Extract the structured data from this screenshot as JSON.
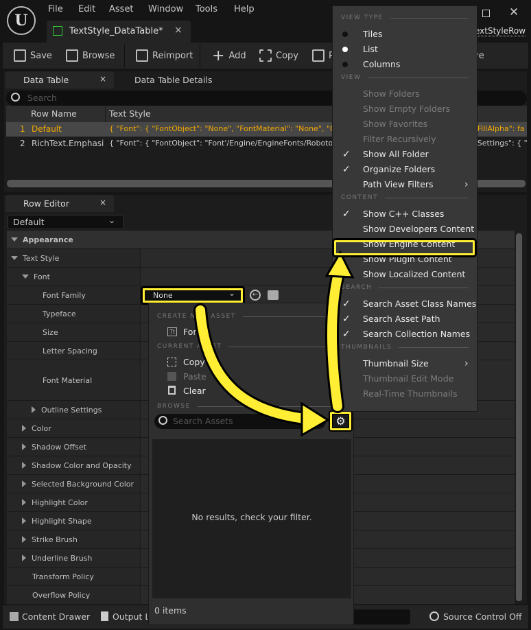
{
  "menu": [
    "File",
    "Edit",
    "Asset",
    "Window",
    "Tools",
    "Help"
  ],
  "asset_tab": {
    "label": "TextStyle_DataTable*",
    "close": "×"
  },
  "row_struct_link": "extStyleRow",
  "toolbar": {
    "save": "Save",
    "browse": "Browse",
    "reimport": "Reimport",
    "add": "Add",
    "copy": "Copy",
    "paste": "P",
    "remove": "ve"
  },
  "panel_tabs": {
    "data_table": "Data Table",
    "details": "Data Table Details",
    "close": "×"
  },
  "search": {
    "placeholder": "Search"
  },
  "table": {
    "headers": [
      "Row Name",
      "Text Style"
    ],
    "rows": [
      {
        "index": "1",
        "name": "Default",
        "value": "{ \"Font\": { \"FontObject\": \"None\", \"FontMaterial\": \"None\", \"Outlin",
        "tail": "eFillAlpha\": fa"
      },
      {
        "index": "2",
        "name": "RichText.Emphasis",
        "value": "{ \"Font\": { \"FontObject\": \"Font'/Engine/EngineFonts/Roboto.R",
        "tail": "eSettings\": { \""
      }
    ]
  },
  "row_editor": {
    "tab": "Row Editor",
    "close": "×",
    "selected_row": "Default",
    "properties": [
      {
        "label": "Appearance",
        "type": "category"
      },
      {
        "label": "Text Style",
        "type": "expanded"
      },
      {
        "label": "Font",
        "type": "expanded"
      },
      {
        "label": "Font Family"
      },
      {
        "label": "Typeface"
      },
      {
        "label": "Size"
      },
      {
        "label": "Letter Spacing"
      },
      {
        "label": "Font Material"
      },
      {
        "label": "Outline Settings",
        "type": "collapsed"
      },
      {
        "label": "Color",
        "type": "collapsed"
      },
      {
        "label": "Shadow Offset",
        "type": "collapsed"
      },
      {
        "label": "Shadow Color and Opacity",
        "type": "collapsed"
      },
      {
        "label": "Selected Background Color",
        "type": "collapsed"
      },
      {
        "label": "Highlight Color",
        "type": "collapsed"
      },
      {
        "label": "Highlight Shape",
        "type": "collapsed"
      },
      {
        "label": "Strike Brush",
        "type": "collapsed"
      },
      {
        "label": "Underline Brush",
        "type": "collapsed"
      },
      {
        "label": "Transform Policy"
      },
      {
        "label": "Overflow Policy"
      }
    ]
  },
  "font_family_value": "None",
  "asset_picker": {
    "create_header": "CREATE NEW ASSET",
    "create_item": "Font",
    "current_header": "CURRENT ASSET",
    "copy": "Copy",
    "paste": "Paste",
    "clear": "Clear",
    "browse_header": "BROWSE",
    "search_placeholder": "Search Assets",
    "empty": "No results, check your filter.",
    "count": "0 items"
  },
  "statusbar": {
    "content_drawer": "Content Drawer",
    "output_log": "Output Log",
    "source_control": "Source Control Off"
  },
  "view_menu": {
    "sections": [
      {
        "header": "VIEW TYPE",
        "items": [
          {
            "label": "Tiles",
            "radio": false
          },
          {
            "label": "List",
            "radio": true
          },
          {
            "label": "Columns",
            "radio": false
          }
        ]
      },
      {
        "header": "VIEW",
        "items": [
          {
            "label": "Show Folders",
            "disabled": true
          },
          {
            "label": "Show Empty Folders",
            "disabled": true
          },
          {
            "label": "Show Favorites",
            "disabled": true
          },
          {
            "label": "Filter Recursively",
            "disabled": true
          },
          {
            "label": "Show All Folder",
            "checked": true
          },
          {
            "label": "Organize Folders",
            "checked": true
          },
          {
            "label": "Path View Filters",
            "submenu": true
          }
        ]
      },
      {
        "header": "CONTENT",
        "items": [
          {
            "label": "Show C++ Classes",
            "checked": true
          },
          {
            "label": "Show Developers Content"
          },
          {
            "label": "Show Engine Content",
            "highlighted": true
          },
          {
            "label": "Show Plugin Content"
          },
          {
            "label": "Show Localized Content"
          }
        ]
      },
      {
        "header": "SEARCH",
        "items": [
          {
            "label": "Search Asset Class Names",
            "checked": true
          },
          {
            "label": "Search Asset Path",
            "checked": true
          },
          {
            "label": "Search Collection Names",
            "checked": true
          }
        ]
      },
      {
        "header": "THUMBNAILS",
        "items": [
          {
            "label": "Thumbnail Size",
            "submenu": true
          },
          {
            "label": "Thumbnail Edit Mode",
            "disabled": true
          },
          {
            "label": "Real-Time Thumbnails",
            "disabled": true
          }
        ]
      }
    ]
  },
  "colors": {
    "highlight": "#ffee33",
    "selected_row_text": "#f2a900",
    "background": "#151515",
    "panel": "#262626"
  }
}
